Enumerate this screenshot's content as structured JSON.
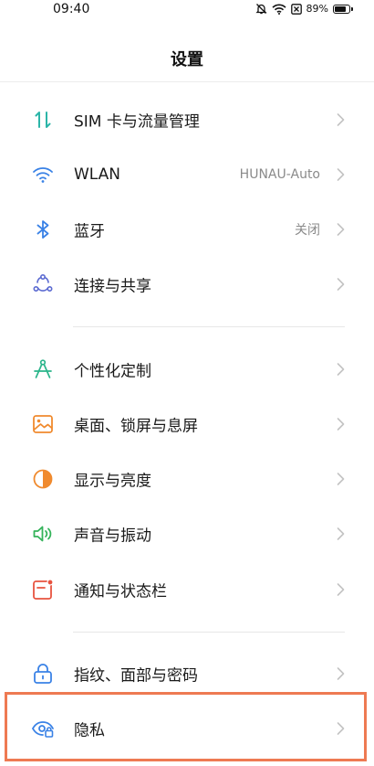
{
  "status_bar": {
    "time": "09:40",
    "battery_percent": "89%",
    "battery_level": 0.89,
    "icons": [
      "mute-bell-icon",
      "wifi-icon",
      "no-sim-icon",
      "battery-icon"
    ]
  },
  "header": {
    "title": "设置"
  },
  "settings": [
    {
      "id": "sim",
      "label": "SIM 卡与流量管理",
      "value": "",
      "icon": "data-transfer-icon",
      "icon_color": "#2bb5a8"
    },
    {
      "id": "wlan",
      "label": "WLAN",
      "value": "HUNAU-Auto",
      "icon": "wifi-icon",
      "icon_color": "#3a82e6"
    },
    {
      "id": "bluetooth",
      "label": "蓝牙",
      "value": "关闭",
      "icon": "bluetooth-icon",
      "icon_color": "#3a82e6"
    },
    {
      "id": "connection",
      "label": "连接与共享",
      "value": "",
      "icon": "connection-share-icon",
      "icon_color": "#5c6bd1"
    },
    {
      "id": "personalize",
      "label": "个性化定制",
      "value": "",
      "icon": "compass-icon",
      "icon_color": "#2bb58b"
    },
    {
      "id": "wallpaper",
      "label": "桌面、锁屏与息屏",
      "value": "",
      "icon": "wallpaper-icon",
      "icon_color": "#f08a2e"
    },
    {
      "id": "display",
      "label": "显示与亮度",
      "value": "",
      "icon": "brightness-icon",
      "icon_color": "#f08a2e"
    },
    {
      "id": "sound",
      "label": "声音与振动",
      "value": "",
      "icon": "speaker-icon",
      "icon_color": "#34b35a"
    },
    {
      "id": "notification",
      "label": "通知与状态栏",
      "value": "",
      "icon": "notification-icon",
      "icon_color": "#e8533f"
    },
    {
      "id": "security",
      "label": "指纹、面部与密码",
      "value": "",
      "icon": "lock-icon",
      "icon_color": "#3a82e6"
    },
    {
      "id": "privacy",
      "label": "隐私",
      "value": "",
      "icon": "privacy-eye-icon",
      "icon_color": "#3a82e6"
    }
  ],
  "highlight": {
    "target": "privacy",
    "color": "#ee7a52"
  }
}
